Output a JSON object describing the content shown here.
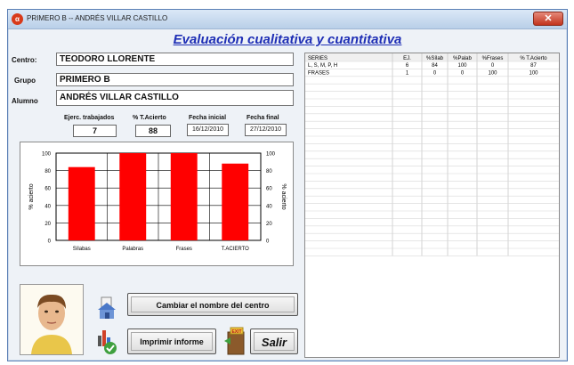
{
  "window": {
    "title": "PRIMERO B  --  ANDRÉS VILLAR CASTILLO",
    "app_icon": "app-icon",
    "close_icon": "close-icon"
  },
  "form": {
    "title": "Evaluación cualitativa y cuantitativa",
    "fields": {
      "centro_label": "Centro:",
      "centro_value": "TEODORO LLORENTE",
      "grupo_label": "Grupo",
      "grupo_value": "PRIMERO B",
      "alumno_label": "Alumno",
      "alumno_value": "ANDRÉS VILLAR CASTILLO"
    },
    "stats": {
      "ejercicios_label": "Ejerc. trabajados",
      "ejercicios_value": "7",
      "acierto_label": "% T.Acierto",
      "acierto_value": "88",
      "fecha_inicial_label": "Fecha inicial",
      "fecha_inicial_value": "16/12/2010",
      "fecha_final_label": "Fecha final",
      "fecha_final_value": "27/12/2010"
    }
  },
  "buttons": {
    "cambiar": "Cambiar el nombre del centro",
    "imprimir": "Imprimir informe",
    "salir": "Salir"
  },
  "icons": {
    "photo": "student-photo",
    "house": "house-icon",
    "print": "report-chart-icon",
    "exit": "exit-door-icon",
    "exit_sign": "EXIT"
  },
  "table": {
    "columns": [
      "SERIES",
      "EJ.",
      "%Sílab",
      "%Palab",
      "%Frases",
      "% T.Acierto"
    ],
    "rows": [
      [
        "L, S, M, P, H",
        "6",
        "84",
        "100",
        "0",
        "87"
      ],
      [
        "FRASES",
        "1",
        "0",
        "0",
        "100",
        "100"
      ]
    ],
    "empty_rows": 24
  },
  "chart_data": {
    "type": "bar",
    "categories": [
      "Sílabas",
      "Palabras",
      "Frases",
      "T.ACIERTO"
    ],
    "values": [
      84,
      100,
      100,
      88
    ],
    "ylabel": "% acierto",
    "ylabel_right": "% acierto",
    "ylim": [
      0,
      100
    ],
    "yticks": [
      "0",
      "20",
      "40",
      "60",
      "80",
      "100"
    ],
    "grid": true,
    "bar_color": "#ff0000"
  }
}
